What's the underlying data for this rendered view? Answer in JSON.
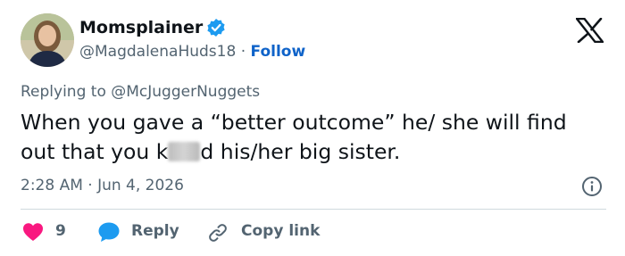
{
  "user": {
    "display_name": "Momsplainer",
    "handle": "@MagdalenaHuds18",
    "separator": " · ",
    "follow_label": "Follow",
    "verified_color": "#1d9bf0"
  },
  "tweet": {
    "replying_prefix": "Replying to ",
    "replying_to": "@McJuggerNuggets",
    "text_before": "When you gave a “better outcome” he/ she will find out that you k",
    "text_after": "d his/her big sister.",
    "timestamp": "2:28 AM · Jun 4, 2026"
  },
  "actions": {
    "like_count": "9",
    "reply_label": "Reply",
    "copy_link_label": "Copy link"
  },
  "icons": {
    "logo": "x-logo-icon",
    "verified": "verified-badge-icon",
    "info": "info-icon",
    "like": "heart-icon",
    "reply": "speech-bubble-icon",
    "copy": "link-icon"
  },
  "colors": {
    "heart": "#f91880",
    "reply_bubble": "#1d9bf0",
    "follow": "#0f63c9",
    "secondary_text": "#536471"
  }
}
